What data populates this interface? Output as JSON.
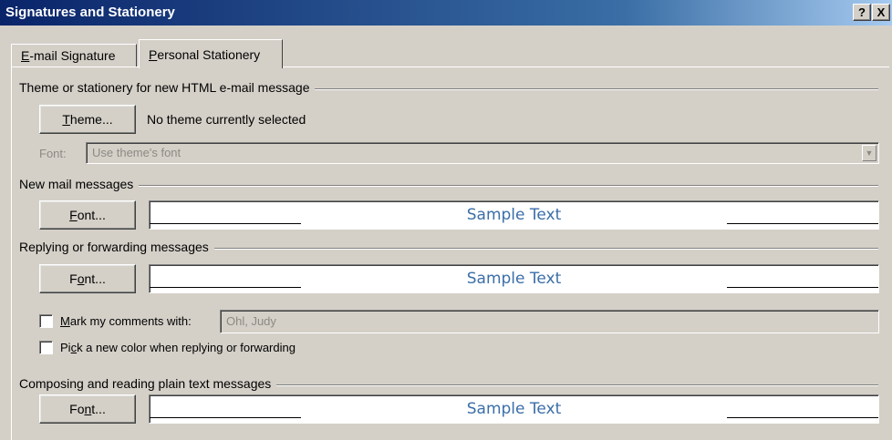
{
  "window": {
    "title": "Signatures and Stationery",
    "help_label": "?",
    "close_label": "X"
  },
  "tabs": [
    {
      "label": "E-mail Signature",
      "mnemonic": "E",
      "rest": "-mail Signature",
      "active": false
    },
    {
      "label": "Personal Stationery",
      "mnemonic": "P",
      "rest": "ersonal Stationery",
      "active": true
    }
  ],
  "theme_group": {
    "label": "Theme or stationery for new HTML e-mail message",
    "theme_button": {
      "pre": "",
      "mnemonic": "T",
      "post": "heme..."
    },
    "status": "No theme currently selected",
    "font_label": "Font:",
    "font_value": "Use theme's font"
  },
  "new_mail": {
    "label": "New mail messages",
    "font_button": {
      "pre": "",
      "mnemonic": "F",
      "post": "ont..."
    },
    "sample": "Sample Text"
  },
  "reply": {
    "label": "Replying or forwarding messages",
    "font_button": {
      "pre": "F",
      "mnemonic": "o",
      "post": "nt..."
    },
    "sample": "Sample Text",
    "mark_comments": {
      "pre": "",
      "mnemonic": "M",
      "post": "ark my comments with:",
      "checked": false,
      "value": "Ohl, Judy"
    },
    "pick_color": {
      "pre": "Pi",
      "mnemonic": "c",
      "post": "k a new color when replying or forwarding",
      "checked": false
    }
  },
  "plain_text": {
    "label": "Composing and reading plain text messages",
    "font_button": {
      "pre": "Fo",
      "mnemonic": "n",
      "post": "t..."
    },
    "sample": "Sample Text"
  },
  "colors": {
    "title_start": "#0a246a",
    "title_end": "#a6caf0",
    "face": "#d4d0c8",
    "sample_text": "#3b6ea8",
    "disabled_text": "#8c8a84"
  }
}
